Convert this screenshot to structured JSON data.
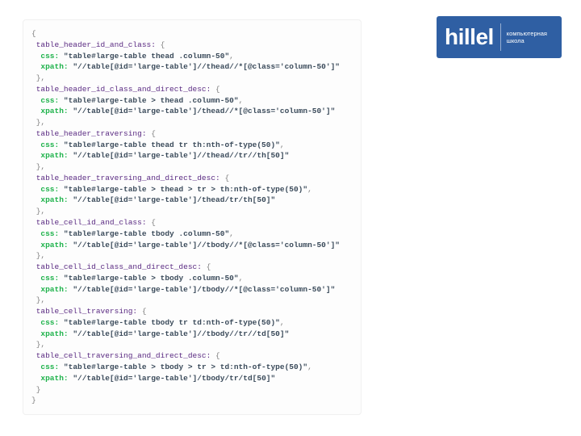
{
  "logo": {
    "word": "hillel",
    "sub1": "компьютерная",
    "sub2": "школа"
  },
  "code": {
    "open": "{",
    "close": "}",
    "entries": [
      {
        "key": "table_header_id_and_class",
        "css": "\"table#large-table thead .column-50\"",
        "xpath": "\"//table[@id='large-table']//thead//*[@class='column-50']\""
      },
      {
        "key": "table_header_id_class_and_direct_desc",
        "css": "\"table#large-table > thead .column-50\"",
        "xpath": "\"//table[@id='large-table']/thead//*[@class='column-50']\""
      },
      {
        "key": "table_header_traversing",
        "css": "\"table#large-table thead tr th:nth-of-type(50)\"",
        "xpath": "\"//table[@id='large-table']//thead//tr//th[50]\""
      },
      {
        "key": "table_header_traversing_and_direct_desc",
        "css": "\"table#large-table > thead > tr > th:nth-of-type(50)\"",
        "xpath": "\"//table[@id='large-table']/thead/tr/th[50]\""
      },
      {
        "key": "table_cell_id_and_class",
        "css": "\"table#large-table tbody .column-50\"",
        "xpath": "\"//table[@id='large-table']//tbody//*[@class='column-50']\""
      },
      {
        "key": "table_cell_id_class_and_direct_desc",
        "css": "\"table#large-table > tbody .column-50\"",
        "xpath": "\"//table[@id='large-table']/tbody//*[@class='column-50']\""
      },
      {
        "key": "table_cell_traversing",
        "css": "\"table#large-table tbody tr td:nth-of-type(50)\"",
        "xpath": "\"//table[@id='large-table']//tbody//tr//td[50]\""
      },
      {
        "key": "table_cell_traversing_and_direct_desc",
        "css": "\"table#large-table > tbody > tr > td:nth-of-type(50)\"",
        "xpath": "\"//table[@id='large-table']/tbody/tr/td[50]\""
      }
    ],
    "cssLabel": "css:",
    "xpathLabel": "xpath:"
  }
}
